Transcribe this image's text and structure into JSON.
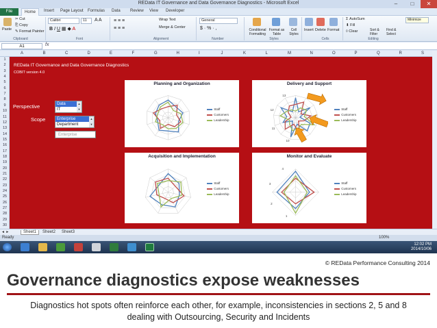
{
  "window": {
    "title": "REData IT Governance and Data Governance Diagnostics - Microsoft Excel",
    "minimize_tooltip": "Minimize"
  },
  "ribbon": {
    "tabs": [
      "File",
      "Home",
      "Insert",
      "Page Layout",
      "Formulas",
      "Data",
      "Review",
      "View",
      "Developer"
    ],
    "clipboard": {
      "paste": "Paste",
      "cut": "Cut",
      "copy": "Copy",
      "format_painter": "Format Painter",
      "group": "Clipboard"
    },
    "font": {
      "name": "Calibri",
      "size": "11",
      "group": "Font"
    },
    "alignment": {
      "wrap": "Wrap Text",
      "merge": "Merge & Center",
      "group": "Alignment"
    },
    "number": {
      "format": "General",
      "group": "Number"
    },
    "styles": {
      "conditional": "Conditional Formatting",
      "format_table": "Format as Table",
      "cell_styles": "Cell Styles",
      "group": "Styles"
    },
    "cells": {
      "insert": "Insert",
      "delete": "Delete",
      "format": "Format",
      "group": "Cells"
    },
    "editing": {
      "autosum": "AutoSum",
      "fill": "Fill",
      "clear": "Clear",
      "sort": "Sort & Filter",
      "find": "Find & Select",
      "group": "Editing"
    }
  },
  "formula_bar": {
    "name_box": "A1",
    "fx": "fx"
  },
  "columns": [
    "A",
    "B",
    "C",
    "D",
    "E",
    "F",
    "G",
    "H",
    "I",
    "J",
    "K",
    "L",
    "M",
    "N",
    "O",
    "P",
    "Q",
    "R",
    "S"
  ],
  "rows": [
    "1",
    "2",
    "3",
    "4",
    "5",
    "6",
    "7",
    "8",
    "9",
    "10",
    "11",
    "12",
    "13",
    "14",
    "15",
    "16",
    "17",
    "18",
    "19",
    "20",
    "21",
    "22",
    "23",
    "24",
    "25",
    "26",
    "27",
    "28",
    "29",
    "30"
  ],
  "sheet": {
    "title": "REData IT Governance and Data Governance Diagnostics",
    "subtitle": "COBIT version 4.0",
    "perspective_label": "Perspective",
    "perspective_options": [
      "Data",
      "IT"
    ],
    "scope_label": "Scope",
    "scope_options": [
      "Enterprise",
      "Department"
    ],
    "scope_value": "Enterprise"
  },
  "charts": [
    {
      "title": "Planning and Organization",
      "legend": [
        "Staff",
        "Customers",
        "Leadership"
      ],
      "colors": [
        "#4f81bd",
        "#c0504d",
        "#9bbb59"
      ]
    },
    {
      "title": "Delivery and Support",
      "legend": [
        "Staff",
        "Customers",
        "Leadership"
      ],
      "colors": [
        "#4f81bd",
        "#c0504d",
        "#9bbb59"
      ],
      "axis_labels": [
        "10",
        "11",
        "12",
        "13"
      ]
    },
    {
      "title": "Acquisition and Implementation",
      "legend": [
        "Staff",
        "Customers",
        "Leadership"
      ],
      "colors": [
        "#4f81bd",
        "#c0504d",
        "#9bbb59"
      ]
    },
    {
      "title": "Monitor and Evaluate",
      "legend": [
        "Staff",
        "Customers",
        "Leadership"
      ],
      "colors": [
        "#4f81bd",
        "#c0504d",
        "#9bbb59"
      ],
      "axis_labels": [
        "1",
        "2",
        "3",
        "4"
      ]
    }
  ],
  "sheet_tabs": [
    "Sheet1",
    "Sheet2",
    "Sheet3"
  ],
  "status": {
    "ready": "Ready",
    "zoom": "100%"
  },
  "clock": {
    "time": "12:02 PM",
    "date": "2014/10/06"
  },
  "slide": {
    "copyright": "© REData Performance Consulting 2014",
    "headline": "Governance diagnostics expose weaknesses",
    "caption": "Diagnostics hot spots often reinforce each other, for example, inconsistencies in sections 2, 5 and 8 dealing with Outsourcing, Security and Incidents"
  },
  "colors": {
    "sheet_bg": "#b50f14",
    "accent": "#a01216",
    "arrow": "#f39a1e"
  }
}
